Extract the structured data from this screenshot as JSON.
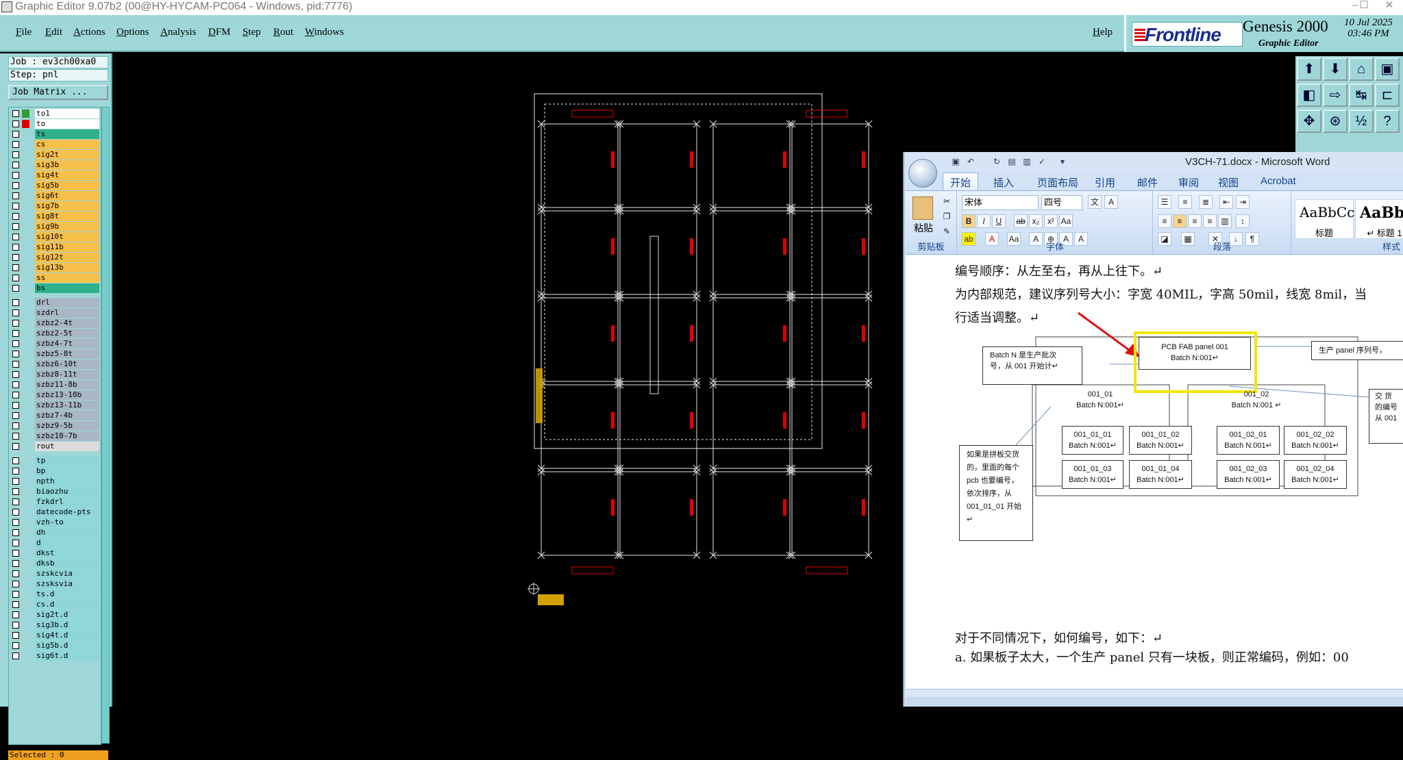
{
  "window": {
    "title": "Graphic Editor 9.07b2 (00@HY-HYCAM-PC064 - Windows, pid:7776)",
    "controls": [
      "–",
      "☐",
      "✕"
    ]
  },
  "menu": {
    "items": [
      "File",
      "Edit",
      "Actions",
      "Options",
      "Analysis",
      "DFM",
      "Step",
      "Rout",
      "Windows"
    ],
    "help": "Help"
  },
  "brand": {
    "logo": "Frontline",
    "product": "Genesis 2000",
    "subtitle": "Graphic Editor",
    "date": "10 Jul 2025",
    "time": "03:46 PM"
  },
  "job": {
    "job_label": "Job : ev3ch00xa0",
    "step_label": "Step: pnl",
    "matrix_button": "Job Matrix ...",
    "selected": "Selected : 0"
  },
  "layers": [
    {
      "name": "to1",
      "color": "#2e9e2e",
      "bg": "#ffffff"
    },
    {
      "name": "to",
      "color": "#e00000",
      "bg": "#ffffff"
    },
    {
      "name": "ts",
      "color": "",
      "bg": "#2fb08a"
    },
    {
      "name": "cs",
      "color": "",
      "bg": "#f7c04a"
    },
    {
      "name": "sig2t",
      "color": "",
      "bg": "#f7c04a"
    },
    {
      "name": "sig3b",
      "color": "",
      "bg": "#f7c04a"
    },
    {
      "name": "sig4t",
      "color": "",
      "bg": "#f7c04a"
    },
    {
      "name": "sig5b",
      "color": "",
      "bg": "#f7c04a"
    },
    {
      "name": "sig6t",
      "color": "",
      "bg": "#f7c04a"
    },
    {
      "name": "sig7b",
      "color": "",
      "bg": "#f7c04a"
    },
    {
      "name": "sig8t",
      "color": "",
      "bg": "#f7c04a"
    },
    {
      "name": "sig9b",
      "color": "",
      "bg": "#f7c04a"
    },
    {
      "name": "sig10t",
      "color": "",
      "bg": "#f7c04a"
    },
    {
      "name": "sig11b",
      "color": "",
      "bg": "#f7c04a"
    },
    {
      "name": "sig12t",
      "color": "",
      "bg": "#f7c04a"
    },
    {
      "name": "sig13b",
      "color": "",
      "bg": "#f7c04a"
    },
    {
      "name": "ss",
      "color": "",
      "bg": "#f7c04a"
    },
    {
      "name": "bs",
      "color": "",
      "bg": "#2fb08a"
    },
    {
      "name": "",
      "color": "",
      "bg": ""
    },
    {
      "name": "drl",
      "color": "",
      "bg": "#a9b7c4"
    },
    {
      "name": "szdrl",
      "color": "",
      "bg": "#a9b7c4"
    },
    {
      "name": "szbz2-4t",
      "color": "",
      "bg": "#a9b7c4"
    },
    {
      "name": "szbz2-5t",
      "color": "",
      "bg": "#a9b7c4"
    },
    {
      "name": "szbz4-7t",
      "color": "",
      "bg": "#a9b7c4"
    },
    {
      "name": "szbz5-8t",
      "color": "",
      "bg": "#a9b7c4"
    },
    {
      "name": "szbz6-10t",
      "color": "",
      "bg": "#a9b7c4"
    },
    {
      "name": "szbz8-11t",
      "color": "",
      "bg": "#a9b7c4"
    },
    {
      "name": "szbz11-8b",
      "color": "",
      "bg": "#a9b7c4"
    },
    {
      "name": "szbz13-10b",
      "color": "",
      "bg": "#a9b7c4"
    },
    {
      "name": "szbz13-11b",
      "color": "",
      "bg": "#a9b7c4"
    },
    {
      "name": "szbz7-4b",
      "color": "",
      "bg": "#a9b7c4"
    },
    {
      "name": "szbz9-5b",
      "color": "",
      "bg": "#a9b7c4"
    },
    {
      "name": "szbz10-7b",
      "color": "",
      "bg": "#a9b7c4"
    },
    {
      "name": "rout",
      "color": "",
      "bg": "#dcdcdc"
    },
    {
      "name": "",
      "color": "",
      "bg": ""
    },
    {
      "name": "tp",
      "color": "",
      "bg": "#8fd6d9"
    },
    {
      "name": "bp",
      "color": "",
      "bg": "#8fd6d9"
    },
    {
      "name": "npth",
      "color": "",
      "bg": "#8fd6d9"
    },
    {
      "name": "biaozhu",
      "color": "",
      "bg": "#8fd6d9"
    },
    {
      "name": "fzkdrl",
      "color": "",
      "bg": "#8fd6d9"
    },
    {
      "name": "datecode-pts",
      "color": "",
      "bg": "#8fd6d9"
    },
    {
      "name": "vzh-to",
      "color": "",
      "bg": "#8fd6d9"
    },
    {
      "name": "dh",
      "color": "",
      "bg": "#8fd6d9"
    },
    {
      "name": "d",
      "color": "",
      "bg": "#8fd6d9"
    },
    {
      "name": "dkst",
      "color": "",
      "bg": "#8fd6d9"
    },
    {
      "name": "dksb",
      "color": "",
      "bg": "#8fd6d9"
    },
    {
      "name": "szskcvia",
      "color": "",
      "bg": "#8fd6d9"
    },
    {
      "name": "szsksvia",
      "color": "",
      "bg": "#8fd6d9"
    },
    {
      "name": "ts.d",
      "color": "",
      "bg": "#8fd6d9"
    },
    {
      "name": "cs.d",
      "color": "",
      "bg": "#8fd6d9"
    },
    {
      "name": "sig2t.d",
      "color": "",
      "bg": "#8fd6d9"
    },
    {
      "name": "sig3b.d",
      "color": "",
      "bg": "#8fd6d9"
    },
    {
      "name": "sig4t.d",
      "color": "",
      "bg": "#8fd6d9"
    },
    {
      "name": "sig5b.d",
      "color": "",
      "bg": "#8fd6d9"
    },
    {
      "name": "sig6t.d",
      "color": "",
      "bg": "#8fd6d9"
    }
  ],
  "toolbox": {
    "icons": [
      "zoom-home-icon",
      "open-icon",
      "home-icon",
      "frame-icon",
      "zoom-window-icon",
      "snap-icon",
      "measure-icon",
      "route-icon",
      "pan-icon",
      "center-icon",
      "ratio-icon",
      "help-icon"
    ]
  },
  "word": {
    "title": "V3CH-71.docx - Microsoft Word",
    "tabs": [
      "开始",
      "插入",
      "页面布局",
      "引用",
      "邮件",
      "审阅",
      "视图",
      "Acrobat"
    ],
    "font_name": "宋体",
    "font_size": "四号",
    "paste_label": "粘贴",
    "groups": [
      "剪贴板",
      "字体",
      "段落",
      "样式"
    ],
    "styles": [
      {
        "preview": "AaBbCc",
        "name": "标题"
      },
      {
        "preview": "AaBb(",
        "name": "↵ 标题 1"
      }
    ],
    "doc": {
      "line1": "编号顺序：从左至右，再从上往下。↵",
      "line2": "为内部规范，建议序列号大小：字宽 40MIL，字高 50mil，线宽 8mil，当",
      "line3": "行适当调整。↵",
      "batch_note_1": "Batch N 是生产批次",
      "batch_note_2": "号，从 001 开始计↵",
      "pcb_line1": "PCB FAB panel 001",
      "pcb_line2": "Batch N:001↵",
      "panel_serial": "生产 panel 序列号，",
      "delivery_1": "交 货",
      "delivery_2": "的编号",
      "delivery_3": "从 001",
      "unit_a_title": "001_01",
      "unit_a_batch": "Batch N:001↵",
      "unit_b_title": "001_02",
      "unit_b_batch": "Batch N:001 ↵",
      "sub_a1": "001_01_01",
      "sub_a2": "001_01_02",
      "sub_a3": "001_01_03",
      "sub_a4": "001_01_04",
      "sub_b1": "001_02_01",
      "sub_b2": "001_02_02",
      "sub_b3": "001_02_03",
      "sub_b4": "001_02_04",
      "sub_batch": "Batch N:001↵",
      "side_note": "如果是拼板交货的，里面的每个 pcb 也要编号，依次排序，从 001_01_01 开始↵",
      "line4": "对于不同情况下，如何编号，如下：↵",
      "line5": "a.  如果板子太大，一个生产 panel 只有一块板，则正常编码，例如：00"
    }
  },
  "colors": {
    "genesis_bg": "#9fd7d8",
    "red_annotation": "#e00000",
    "highlight_box": "#f2e600"
  }
}
